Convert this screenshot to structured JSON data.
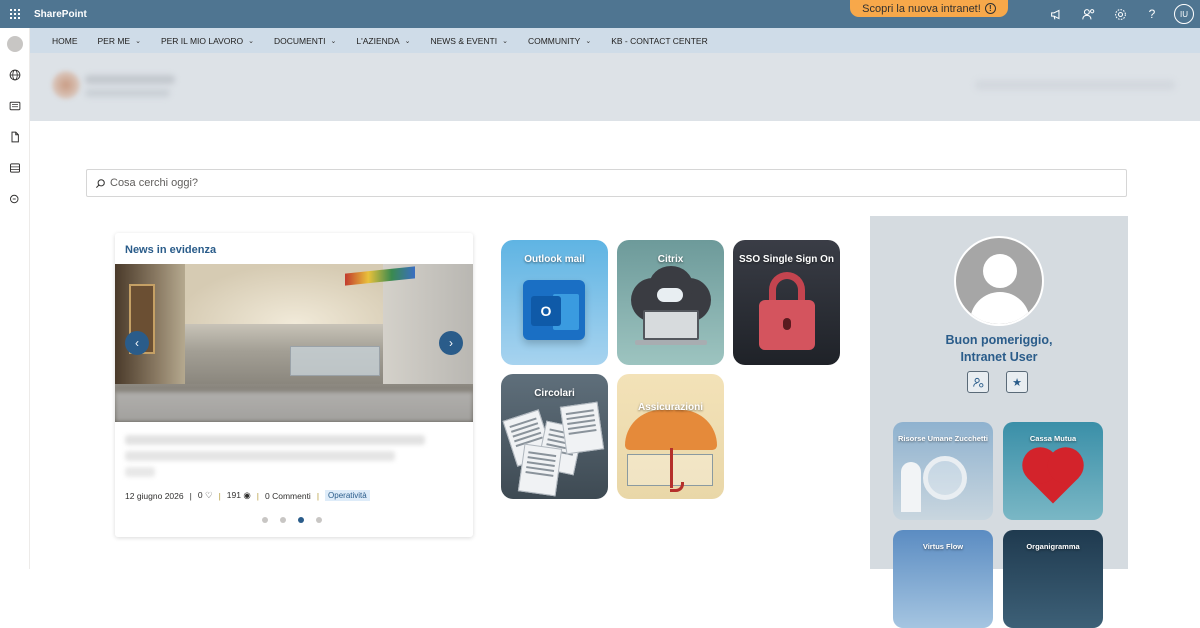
{
  "suitebar": {
    "brand": "SharePoint",
    "promo": "Scopri la nuova intranet!",
    "promo_icon": "!",
    "user_initials": "IU",
    "help": "?"
  },
  "nav": {
    "items": [
      {
        "label": "HOME",
        "has_dropdown": false
      },
      {
        "label": "PER ME",
        "has_dropdown": true
      },
      {
        "label": "PER IL MIO LAVORO",
        "has_dropdown": true
      },
      {
        "label": "DOCUMENTI",
        "has_dropdown": true
      },
      {
        "label": "L'AZIENDA",
        "has_dropdown": true
      },
      {
        "label": "NEWS & EVENTI",
        "has_dropdown": true
      },
      {
        "label": "COMMUNITY",
        "has_dropdown": true
      },
      {
        "label": "KB - CONTACT CENTER",
        "has_dropdown": false
      }
    ]
  },
  "search": {
    "placeholder": "Cosa cerchi oggi?"
  },
  "news": {
    "title": "News in evidenza",
    "date": "12 giugno 2026",
    "likes": "0",
    "views": "191",
    "comments": "0 Commenti",
    "tag": "Operatività",
    "slides": 4,
    "active_slide": 3
  },
  "quicklinks": [
    {
      "label": "Outlook mail"
    },
    {
      "label": "Citrix"
    },
    {
      "label": "SSO Single Sign On"
    },
    {
      "label": "Circolari"
    },
    {
      "label": "Assicurazioni"
    }
  ],
  "profile": {
    "greeting_line1": "Buon pomeriggio,",
    "greeting_line2": "Intranet User",
    "tiles": [
      {
        "label": "Risorse Umane Zucchetti"
      },
      {
        "label": "Cassa Mutua"
      },
      {
        "label": "Virtus Flow"
      },
      {
        "label": "Organigramma"
      }
    ]
  },
  "colors": {
    "suitebar": "#4f7591",
    "navbar": "#cfdce8",
    "accent": "#2a5c8a",
    "promo": "#f7a84a"
  }
}
